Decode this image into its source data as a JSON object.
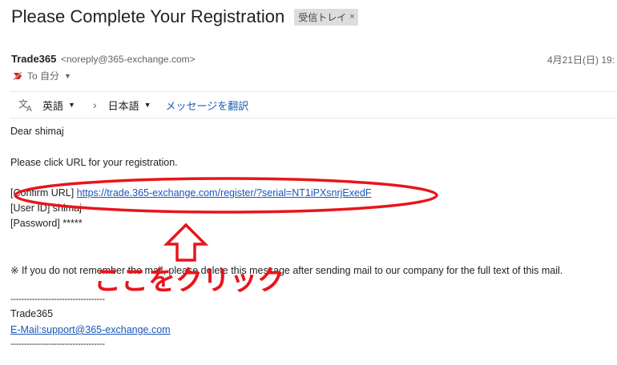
{
  "header": {
    "subject": "Please Complete Your Registration",
    "label": "受信トレイ",
    "label_close": "×"
  },
  "sender": {
    "name": "Trade365",
    "email": "<noreply@365-exchange.com>",
    "date": "4月21日(日) 19:",
    "to": "To 自分"
  },
  "translate": {
    "source_lang": "英語",
    "target_lang": "日本語",
    "action": "メッセージを翻訳"
  },
  "body": {
    "greeting": "Dear shimaj",
    "intro": "Please click URL for your registration.",
    "confirm_label": "[Confirm URL]",
    "confirm_url": "https://trade.365-exchange.com/register/?serial=NT1iPXsnrjExedF",
    "user_id": "[User ID] shimaj",
    "password": "[Password] *****",
    "note": "※ If you do not remember the mail, please delete this message after sending mail to our company for the full text of this mail.",
    "divider1": "-----------------------------------",
    "signature_name": "Trade365",
    "signature_email": "E-Mail:support@365-exchange.com",
    "divider2": "-----------------------------------"
  },
  "annotation": {
    "text": "ここをクリック",
    "color": "#e8151b"
  },
  "icons": [
    "label-important-icon",
    "translate-icon",
    "chevron-right-icon",
    "dropdown-arrow-icon"
  ]
}
